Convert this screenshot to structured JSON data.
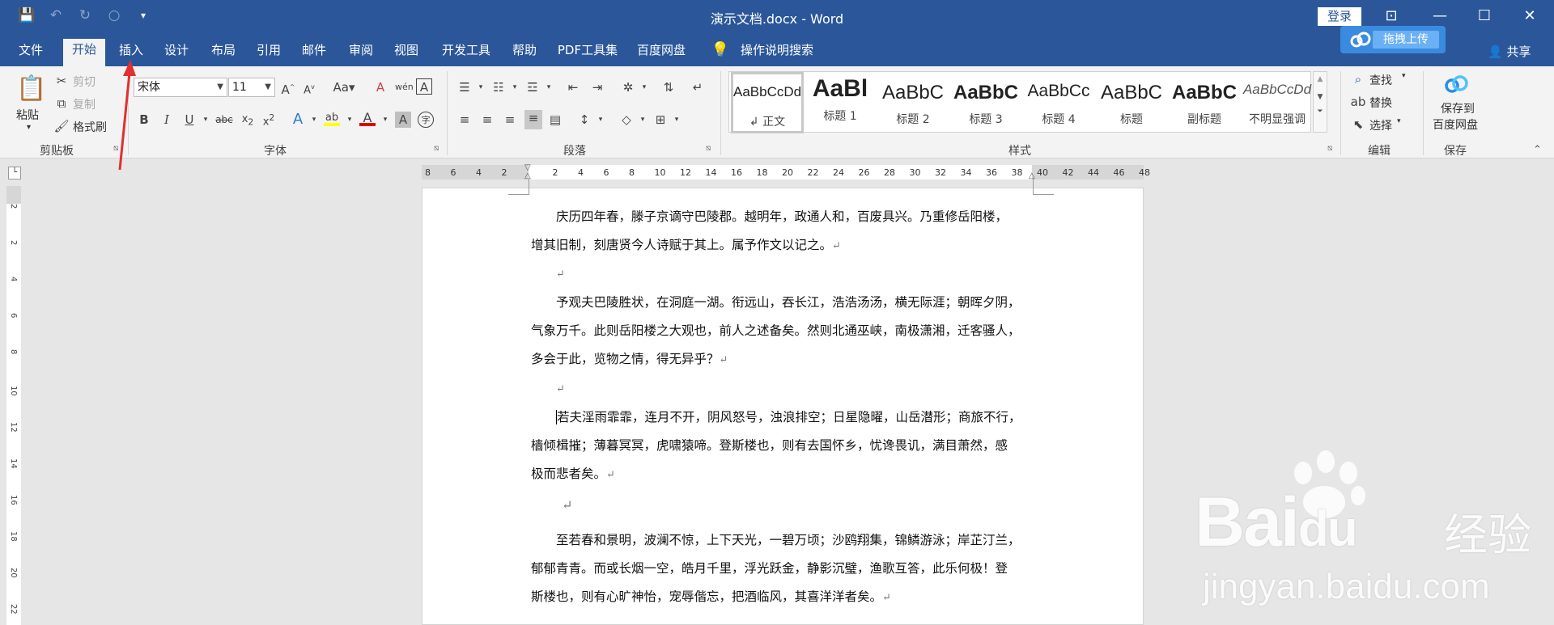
{
  "window": {
    "title": "演示文档.docx - Word",
    "login": "登录",
    "share": "共享",
    "upload": "拖拽上传"
  },
  "tabs": [
    "文件",
    "开始",
    "插入",
    "设计",
    "布局",
    "引用",
    "邮件",
    "审阅",
    "视图",
    "开发工具",
    "帮助",
    "PDF工具集",
    "百度网盘"
  ],
  "tell_me": "操作说明搜索",
  "clipboard": {
    "paste": "粘贴",
    "cut": "剪切",
    "copy": "复制",
    "format_painter": "格式刷",
    "label": "剪贴板"
  },
  "font": {
    "name": "宋体",
    "size": "11",
    "label": "字体"
  },
  "paragraph": {
    "label": "段落"
  },
  "styles": {
    "label": "样式",
    "items": [
      {
        "preview": "AaBbCcDd",
        "name": "↲ 正文"
      },
      {
        "preview": "AaBl",
        "name": "标题 1"
      },
      {
        "preview": "AaBbC",
        "name": "标题 2"
      },
      {
        "preview": "AaBbC",
        "name": "标题 3"
      },
      {
        "preview": "AaBbCc",
        "name": "标题 4"
      },
      {
        "preview": "AaBbC",
        "name": "标题"
      },
      {
        "preview": "AaBbC",
        "name": "副标题"
      },
      {
        "preview": "AaBbCcDd",
        "name": "不明显强调"
      }
    ]
  },
  "editing": {
    "find": "查找",
    "replace": "替换",
    "select": "选择",
    "label": "编辑"
  },
  "save": {
    "btn1": "保存到",
    "btn2": "百度网盘",
    "label": "保存"
  },
  "ruler": [
    "8",
    "6",
    "4",
    "2",
    "",
    "2",
    "4",
    "6",
    "8",
    "10",
    "12",
    "14",
    "16",
    "18",
    "20",
    "22",
    "24",
    "26",
    "28",
    "30",
    "32",
    "34",
    "36",
    "38",
    "40",
    "42",
    "44",
    "46",
    "48"
  ],
  "vruler": [
    "2",
    "",
    "2",
    "",
    "4",
    "",
    "6",
    "",
    "8",
    "",
    "10",
    "",
    "12",
    "",
    "14",
    "",
    "16",
    "",
    "18",
    "",
    "20",
    "",
    "22"
  ],
  "document": {
    "p1": [
      "庆历四年春，滕子京谪守巴陵郡。越明年，政通人和，百废具兴。乃重修岳阳楼，",
      "增其旧制，刻唐贤今人诗赋于其上。属予作文以记之。"
    ],
    "p2": [
      "予观夫巴陵胜状，在洞庭一湖。衔远山，吞长江，浩浩汤汤，横无际涯；朝晖夕阴，",
      "气象万千。此则岳阳楼之大观也，前人之述备矣。然则北通巫峡，南极潇湘，迁客骚人，",
      "多会于此，览物之情，得无异乎？"
    ],
    "p3": [
      "若夫淫雨霏霏，连月不开，阴风怒号，浊浪排空；日星隐曜，山岳潜形；商旅不行，",
      "樯倾楫摧；薄暮冥冥，虎啸猿啼。登斯楼也，则有去国怀乡，忧谗畏讥，满目萧然，感",
      "极而悲者矣。"
    ],
    "p4": [
      "至若春和景明，波澜不惊，上下天光，一碧万顷；沙鸥翔集，锦鳞游泳；岸芷汀兰，",
      "郁郁青青。而或长烟一空，皓月千里，浮光跃金，静影沉璧，渔歌互答，此乐何极！登",
      "斯楼也，则有心旷神怡，宠辱偕忘，把酒临风，其喜洋洋者矣。"
    ],
    "para_mark": "↵"
  },
  "watermark": {
    "brand": "Bai",
    "du": "du",
    "cn": "经验",
    "url": "jingyan.baidu.com"
  },
  "colors": {
    "ribbon_blue": "#2b579a",
    "highlight": "#ffff00",
    "font_red": "#e00000"
  }
}
